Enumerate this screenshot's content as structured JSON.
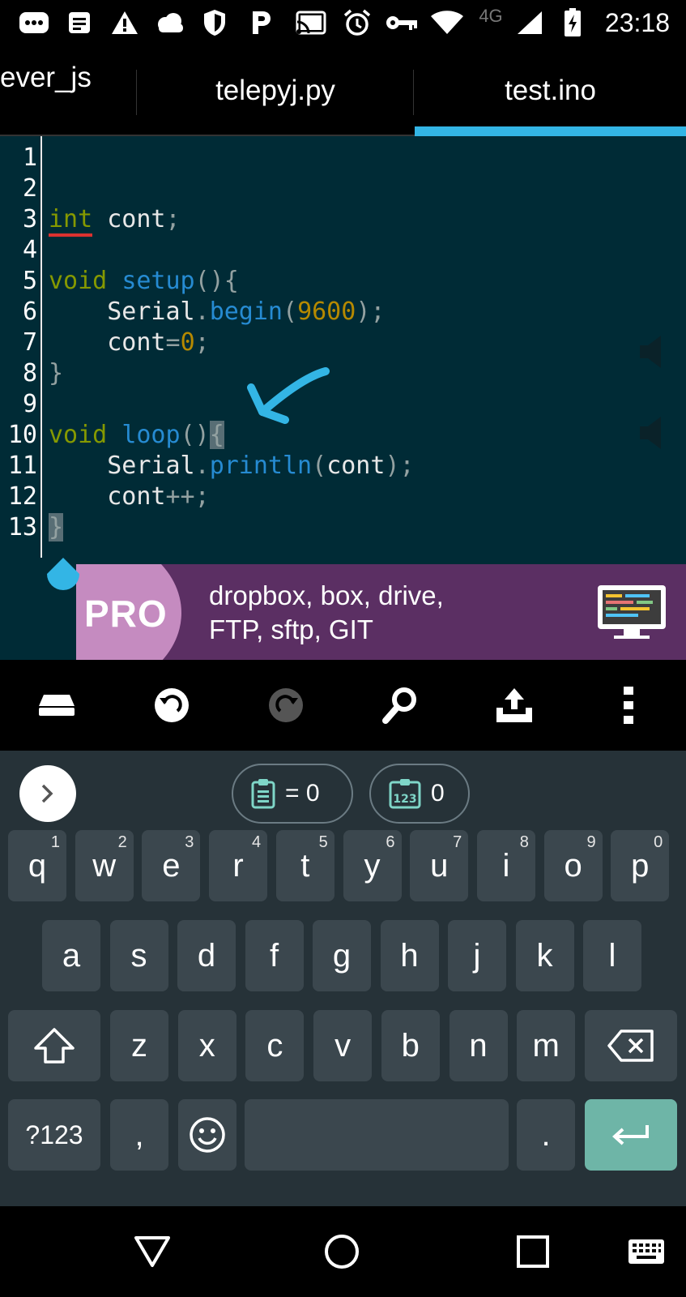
{
  "status_bar": {
    "time": "23:18",
    "network_type": "4G",
    "icons": [
      "chat-icon",
      "document-icon",
      "warning-icon",
      "cloud-icon",
      "shield-icon",
      "parking-icon",
      "cast-icon",
      "alarm-icon",
      "key-icon",
      "wifi-icon",
      "signal-icon",
      "battery-charging-icon"
    ]
  },
  "tabs": [
    {
      "label": "ever_js",
      "active": false
    },
    {
      "label": "telepyj.py",
      "active": false
    },
    {
      "label": "test.ino",
      "active": true
    }
  ],
  "accent_color": "#33b5e5",
  "editor": {
    "line_numbers": [
      "1",
      "2",
      "3",
      "4",
      "5",
      "6",
      "7",
      "8",
      "9",
      "10",
      "11",
      "12",
      "13"
    ],
    "lines": [
      {
        "kind": "empty"
      },
      {
        "kind": "empty"
      },
      {
        "kind": "decl",
        "type": "int",
        "rest": " cont",
        "end": ";"
      },
      {
        "kind": "empty"
      },
      {
        "kind": "func",
        "ret": "void",
        "name": "setup",
        "paren": "()",
        "brace": "{"
      },
      {
        "kind": "call",
        "obj": "    Serial",
        "dot": ".",
        "method": "begin",
        "open": "(",
        "arg": "9600",
        "close": ");"
      },
      {
        "kind": "assign",
        "var": "    cont",
        "op": "=",
        "value": "0",
        "end": ";"
      },
      {
        "kind": "close",
        "brace": "}"
      },
      {
        "kind": "empty"
      },
      {
        "kind": "func",
        "ret": "void",
        "name": "loop",
        "paren": "()",
        "brace": "{"
      },
      {
        "kind": "call2",
        "obj": "    Serial",
        "dot": ".",
        "method": "println",
        "open": "(",
        "arg": "cont",
        "close": ");"
      },
      {
        "kind": "inc",
        "var": "    cont",
        "op": "++",
        "end": ";"
      },
      {
        "kind": "close",
        "brace": "}"
      }
    ]
  },
  "banner": {
    "badge": "PRO",
    "line1": "dropbox, box, drive,",
    "line2": "FTP, sftp, GIT"
  },
  "toolbar": {
    "buttons": [
      "drive-icon",
      "undo-icon",
      "redo-icon",
      "search-icon",
      "upload-icon",
      "more-vert-icon"
    ]
  },
  "keyboard": {
    "clip1_text": "= 0",
    "clip2_text": "0",
    "row1": [
      {
        "k": "q",
        "h": "1"
      },
      {
        "k": "w",
        "h": "2"
      },
      {
        "k": "e",
        "h": "3"
      },
      {
        "k": "r",
        "h": "4"
      },
      {
        "k": "t",
        "h": "5"
      },
      {
        "k": "y",
        "h": "6"
      },
      {
        "k": "u",
        "h": "7"
      },
      {
        "k": "i",
        "h": "8"
      },
      {
        "k": "o",
        "h": "9"
      },
      {
        "k": "p",
        "h": "0"
      }
    ],
    "row2": [
      "a",
      "s",
      "d",
      "f",
      "g",
      "h",
      "j",
      "k",
      "l"
    ],
    "row3": [
      "z",
      "x",
      "c",
      "v",
      "b",
      "n",
      "m"
    ],
    "sym_label": "?123",
    "comma_label": ",",
    "period_label": "."
  },
  "colors": {
    "editor_bg": "#002b36",
    "keyword": "#859900",
    "function": "#268bd2",
    "number": "#b58900",
    "banner_bg": "#5b2f63",
    "keyboard_bg": "#263238",
    "enter_key": "#6eb5a7"
  }
}
